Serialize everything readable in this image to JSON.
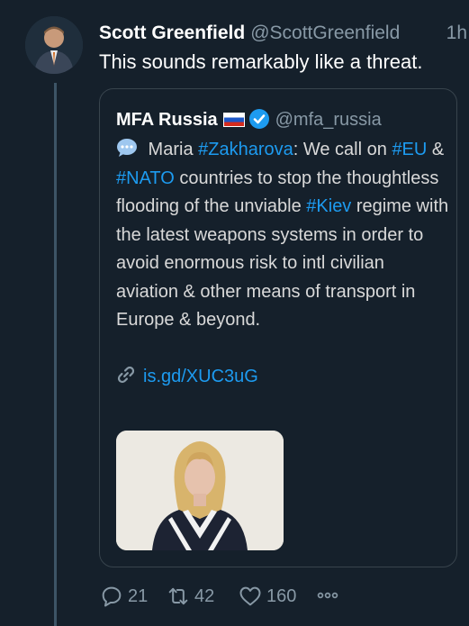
{
  "tweet": {
    "author_name": "Scott Greenfield",
    "author_handle": "@ScottGreenfield",
    "time": "1h",
    "text": "This sounds remarkably like a threat."
  },
  "quote": {
    "author_name": "MFA Russia",
    "author_handle": "@mfa_russia",
    "text": {
      "p1": " Maria ",
      "tag1": "#Zakharova",
      "p2": ": We call on ",
      "tag2": "#EU",
      "p3": " & ",
      "tag3": "#NATO",
      "p4": " countries to stop the thoughtless flooding of the unviable ",
      "tag4": "#Kiev",
      "p5": " regime with the latest weapons systems in order to avoid enormous risk to intl civilian aviation & other means of transport in Europe & beyond."
    },
    "link": "is.gd/XUC3uG"
  },
  "actions": {
    "replies": "21",
    "retweets": "42",
    "likes": "160"
  },
  "colors": {
    "background": "#15202b",
    "accent": "#1d9bf0",
    "muted": "#8899a6",
    "border": "#38444d"
  }
}
